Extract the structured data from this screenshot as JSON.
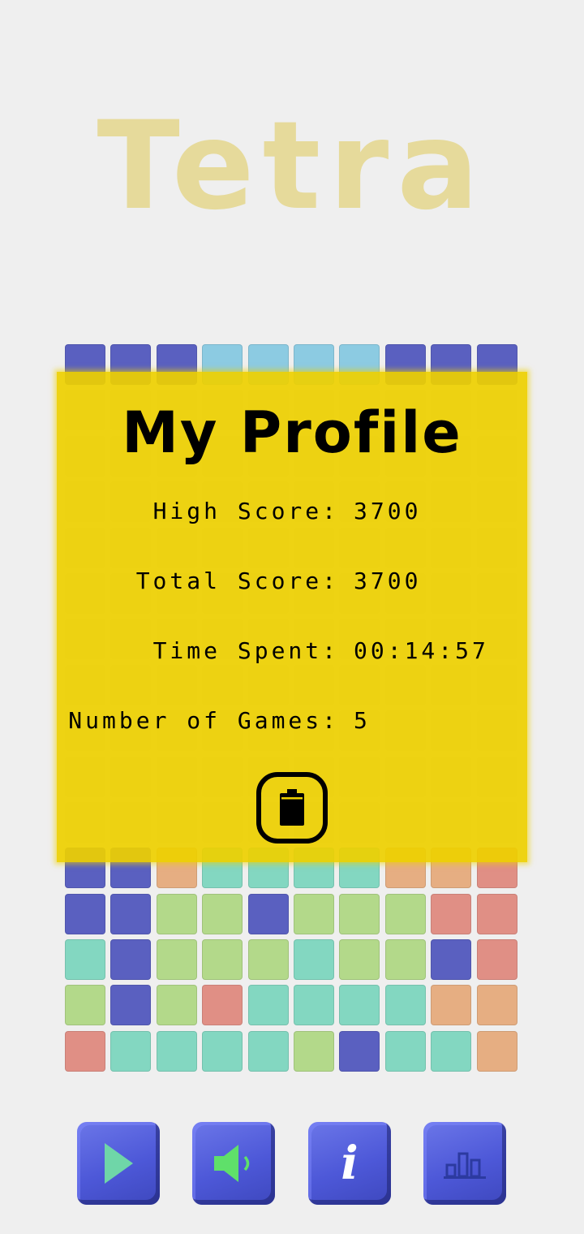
{
  "app": {
    "title": "Tetra"
  },
  "colors": {
    "navy": "#5a60c0",
    "sky": "#8ccbe2",
    "teal": "#83d7c1",
    "green": "#b3d98a",
    "orange": "#e6ae82",
    "salmon": "#e08f85",
    "empty": "#e6e6e6",
    "overlay": "#eed000",
    "button": "#4d58d8"
  },
  "board": {
    "rows": [
      [
        "navy",
        "navy",
        "navy",
        "sky",
        "sky",
        "sky",
        "sky",
        "navy",
        "navy",
        "navy"
      ],
      [
        "e",
        "e",
        "e",
        "e",
        "e",
        "e",
        "e",
        "e",
        "e",
        "e"
      ],
      [
        "e",
        "e",
        "e",
        "e",
        "e",
        "e",
        "e",
        "e",
        "e",
        "e"
      ],
      [
        "e",
        "e",
        "e",
        "e",
        "e",
        "e",
        "e",
        "e",
        "e",
        "e"
      ],
      [
        "e",
        "e",
        "e",
        "e",
        "e",
        "e",
        "e",
        "e",
        "e",
        "e"
      ],
      [
        "e",
        "e",
        "e",
        "e",
        "e",
        "e",
        "e",
        "e",
        "e",
        "e"
      ],
      [
        "e",
        "e",
        "e",
        "e",
        "e",
        "e",
        "e",
        "e",
        "e",
        "e"
      ],
      [
        "e",
        "e",
        "e",
        "e",
        "e",
        "e",
        "e",
        "e",
        "e",
        "e"
      ],
      [
        "e",
        "e",
        "e",
        "e",
        "e",
        "e",
        "e",
        "e",
        "e",
        "e"
      ],
      [
        "e",
        "e",
        "e",
        "e",
        "e",
        "e",
        "e",
        "e",
        "e",
        "e"
      ],
      [
        "e",
        "e",
        "e",
        "e",
        "e",
        "e",
        "e",
        "e",
        "e",
        "e"
      ],
      [
        "navy",
        "navy",
        "orange",
        "teal",
        "teal",
        "teal",
        "teal",
        "orange",
        "orange",
        "salmon"
      ],
      [
        "navy",
        "navy",
        "green",
        "green",
        "navy",
        "green",
        "green",
        "green",
        "salmon",
        "salmon"
      ],
      [
        "teal",
        "navy",
        "green",
        "green",
        "green",
        "teal",
        "green",
        "green",
        "navy",
        "salmon"
      ],
      [
        "green",
        "navy",
        "green",
        "salmon",
        "teal",
        "teal",
        "teal",
        "teal",
        "orange",
        "orange"
      ],
      [
        "salmon",
        "teal",
        "teal",
        "teal",
        "teal",
        "green",
        "navy",
        "teal",
        "teal",
        "orange"
      ]
    ]
  },
  "profile": {
    "title": "My Profile",
    "high_score_label": "High Score:",
    "high_score_value": "3700",
    "total_score_label": "Total Score:",
    "total_score_value": "3700",
    "time_spent_label": "Time Spent:",
    "time_spent_value": "00:14:57",
    "games_label": "Number of Games:",
    "games_value": "5",
    "delete_icon": "trash-icon"
  },
  "controls": [
    {
      "name": "play-button",
      "icon": "play-icon"
    },
    {
      "name": "sound-button",
      "icon": "speaker-icon"
    },
    {
      "name": "info-button",
      "icon": "info-icon",
      "glyph": "i"
    },
    {
      "name": "stats-button",
      "icon": "bar-chart-icon"
    }
  ]
}
